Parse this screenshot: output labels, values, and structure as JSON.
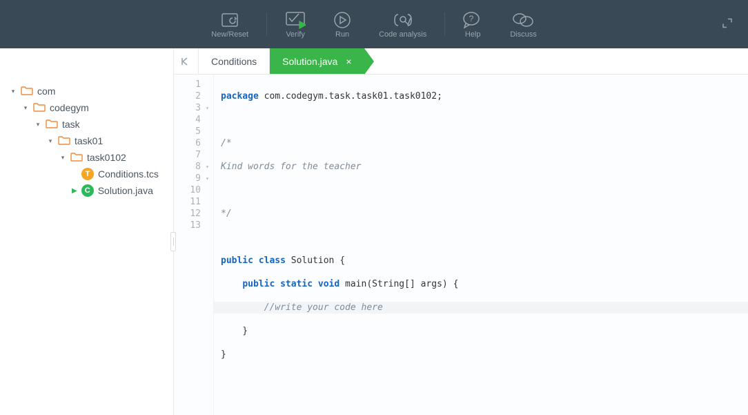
{
  "toolbar": {
    "new_reset": "New/Reset",
    "verify": "Verify",
    "run": "Run",
    "code_analysis": "Code analysis",
    "help": "Help",
    "discuss": "Discuss"
  },
  "tabs": {
    "conditions": "Conditions",
    "solution": "Solution.java"
  },
  "tree": {
    "com": "com",
    "codegym": "codegym",
    "task": "task",
    "task01": "task01",
    "task0102": "task0102",
    "conditions_file": "Conditions.tcs",
    "solution_file": "Solution.java",
    "badge_t": "T",
    "badge_c": "C"
  },
  "code": {
    "l1a": "package",
    "l1b": " com.codegym.task.task01.task0102;",
    "l3": "/*",
    "l4": "Kind words for the teacher",
    "l6": "*/",
    "l8a": "public class",
    "l8b": " Solution {",
    "l9a": "    ",
    "l9b": "public static void",
    "l9c": " main(String[] args) {",
    "l10": "        //write your code here",
    "l11": "    }",
    "l12": "}"
  },
  "line_numbers": [
    "1",
    "2",
    "3",
    "4",
    "5",
    "6",
    "7",
    "8",
    "9",
    "10",
    "11",
    "12",
    "13"
  ]
}
